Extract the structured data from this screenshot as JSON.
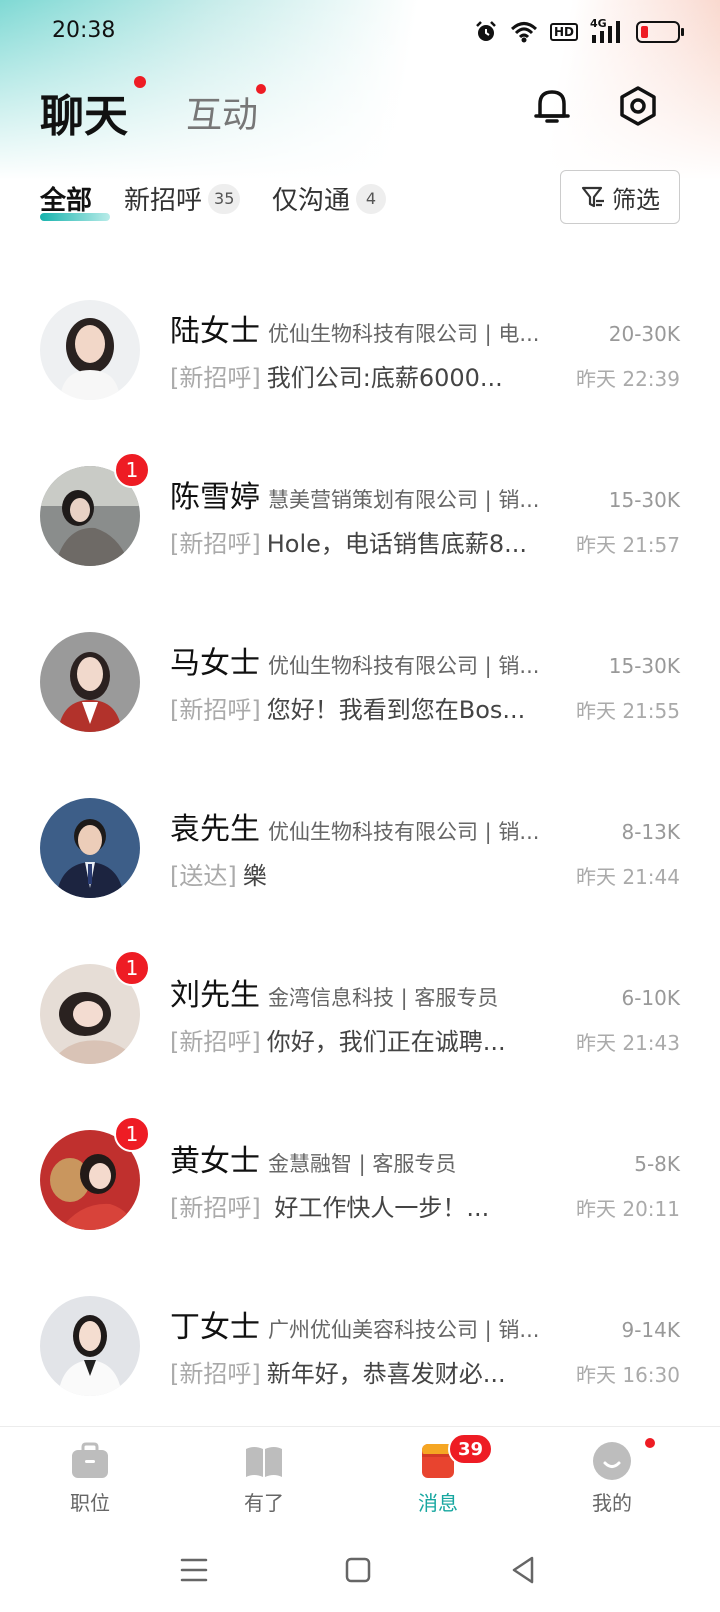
{
  "status_bar": {
    "time": "20:38",
    "icons": [
      "alarm-icon",
      "wifi-icon",
      "hd-icon",
      "signal-4g-icon",
      "battery-icon"
    ],
    "hd_label": "HD",
    "network_label": "4G",
    "battery_level": 0.2,
    "battery_color": "#ee1c24"
  },
  "header": {
    "tab_chat": "聊天",
    "tab_interact": "互动",
    "bell_icon": "bell-icon",
    "settings_icon": "settings-icon"
  },
  "subtabs": {
    "all": "全部",
    "new_greeting": "新招呼",
    "new_greeting_count": "35",
    "only_chat": "仅沟通",
    "only_chat_count": "4",
    "filter_label": "筛选"
  },
  "chats": [
    {
      "name": "陆女士",
      "company": "优仙生物科技有限公司 | 电...",
      "salary": "20-30K",
      "tag": "[新招呼]",
      "message": "我们公司:底薪6000...",
      "time": "昨天 22:39",
      "unread": ""
    },
    {
      "name": "陈雪婷",
      "company": "慧美营销策划有限公司 | 销...",
      "salary": "15-30K",
      "tag": "[新招呼]",
      "message": "Hole，电话销售底薪8...",
      "time": "昨天 21:57",
      "unread": "1"
    },
    {
      "name": "马女士",
      "company": "优仙生物科技有限公司 | 销...",
      "salary": "15-30K",
      "tag": "[新招呼]",
      "message": "您好！我看到您在Bos...",
      "time": "昨天 21:55",
      "unread": ""
    },
    {
      "name": "袁先生",
      "company": "优仙生物科技有限公司 | 销...",
      "salary": "8-13K",
      "tag": "[送达]",
      "message": "樂",
      "time": "昨天 21:44",
      "unread": ""
    },
    {
      "name": "刘先生",
      "company": "金湾信息科技 | 客服专员",
      "salary": "6-10K",
      "tag": "[新招呼]",
      "message": "你好，我们正在诚聘...",
      "time": "昨天 21:43",
      "unread": "1"
    },
    {
      "name": "黄女士",
      "company": "金慧融智 | 客服专员",
      "salary": "5-8K",
      "tag": "[新招呼]",
      "message": " 好工作快人一步！...",
      "time": "昨天 20:11",
      "unread": "1"
    },
    {
      "name": "丁女士",
      "company": "广州优仙美容科技公司 | 销...",
      "salary": "9-14K",
      "tag": "[新招呼]",
      "message": "新年好，恭喜发财必...",
      "time": "昨天 16:30",
      "unread": ""
    }
  ],
  "bottom_nav": {
    "jobs": "职位",
    "youle": "有了",
    "messages": "消息",
    "messages_badge": "39",
    "mine": "我的"
  },
  "colors": {
    "accent": "#17a7a0",
    "badge_red": "#ee1c24"
  }
}
